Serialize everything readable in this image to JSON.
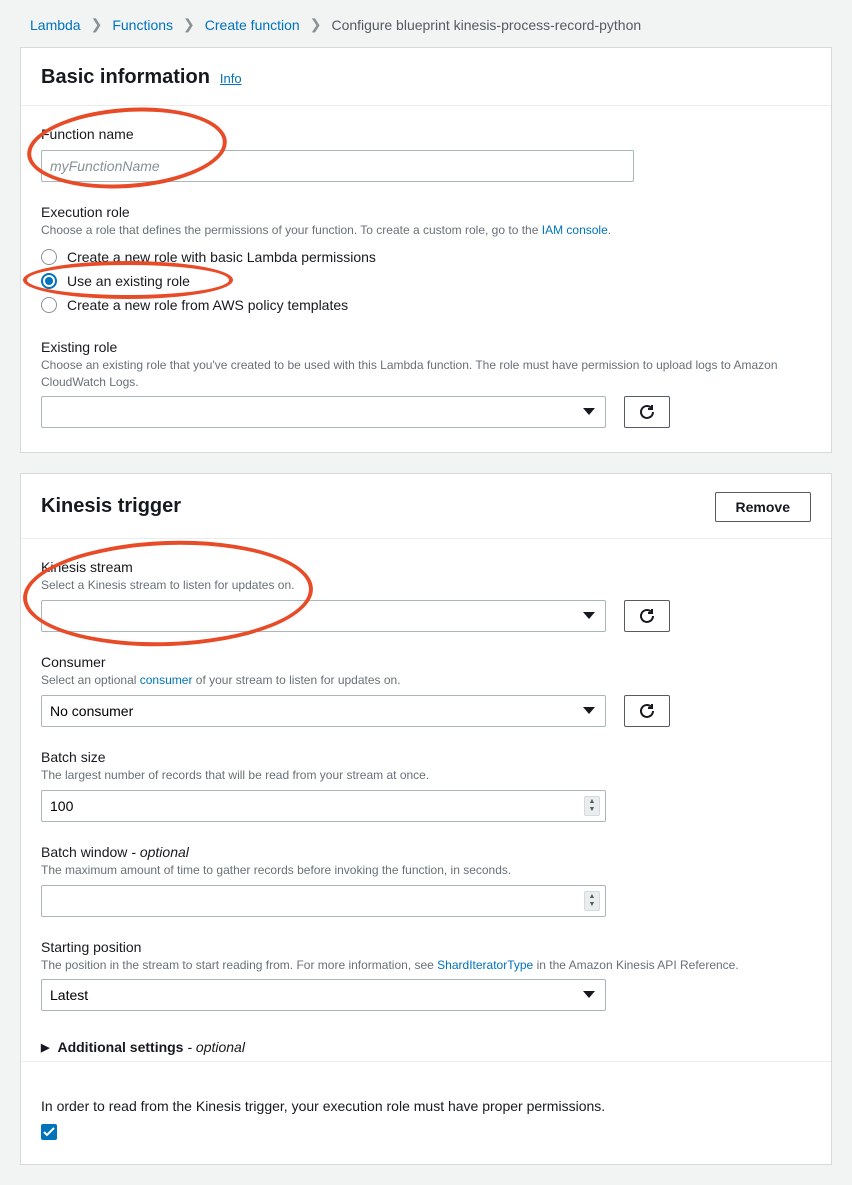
{
  "breadcrumb": {
    "lambda": "Lambda",
    "functions": "Functions",
    "create": "Create function",
    "current": "Configure blueprint kinesis-process-record-python"
  },
  "basic": {
    "title": "Basic information",
    "info": "Info",
    "functionName": {
      "label": "Function name",
      "placeholder": "myFunctionName",
      "value": ""
    },
    "executionRole": {
      "label": "Execution role",
      "help_pre": "Choose a role that defines the permissions of your function. To create a custom role, go to the ",
      "help_link": "IAM console",
      "help_post": ".",
      "options": [
        "Create a new role with basic Lambda permissions",
        "Use an existing role",
        "Create a new role from AWS policy templates"
      ],
      "selected": 1
    },
    "existingRole": {
      "label": "Existing role",
      "help": "Choose an existing role that you've created to be used with this Lambda function. The role must have permission to upload logs to Amazon CloudWatch Logs.",
      "value": ""
    }
  },
  "kinesis": {
    "title": "Kinesis trigger",
    "removeLabel": "Remove",
    "stream": {
      "label": "Kinesis stream",
      "help": "Select a Kinesis stream to listen for updates on.",
      "value": ""
    },
    "consumer": {
      "label": "Consumer",
      "help_pre": "Select an optional ",
      "help_link": "consumer",
      "help_post": " of your stream to listen for updates on.",
      "value": "No consumer"
    },
    "batchSize": {
      "label": "Batch size",
      "help": "The largest number of records that will be read from your stream at once.",
      "value": "100"
    },
    "batchWindow": {
      "label_main": "Batch window",
      "label_opt": " - optional",
      "help": "The maximum amount of time to gather records before invoking the function, in seconds.",
      "value": ""
    },
    "startingPosition": {
      "label": "Starting position",
      "help_pre": "The position in the stream to start reading from. For more information, see ",
      "help_link": "ShardIteratorType",
      "help_post": " in the Amazon Kinesis API Reference.",
      "value": "Latest"
    },
    "additional": {
      "label": "Additional settings",
      "opt": " - optional"
    },
    "notice": "In order to read from the Kinesis trigger, your execution role must have proper permissions.",
    "agree": true
  }
}
